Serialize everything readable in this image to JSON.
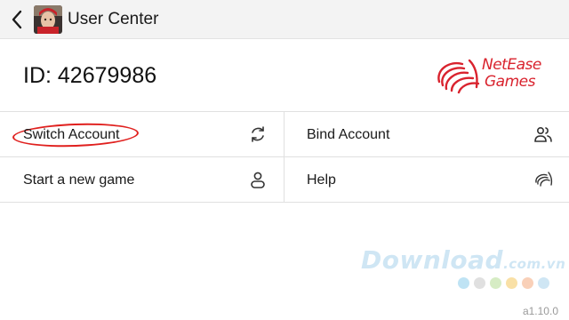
{
  "header": {
    "title": "User Center"
  },
  "account": {
    "id_text": "ID: 42679986"
  },
  "brand": {
    "logo_line1": "NetEase",
    "logo_line2": "Games",
    "color": "#d9232e"
  },
  "menu": {
    "items": [
      {
        "label": "Switch Account",
        "icon": "refresh-icon"
      },
      {
        "label": "Bind Account",
        "icon": "users-icon"
      },
      {
        "label": "Start a new game",
        "icon": "user-icon"
      },
      {
        "label": "Help",
        "icon": "netease-icon"
      }
    ]
  },
  "watermark": {
    "main": "Download",
    "suffix": ".com.vn",
    "dot_colors": [
      "#bfe3f4",
      "#e0e0e0",
      "#d6ecc4",
      "#f9e0a6",
      "#f9d0b8",
      "#cfe6f4"
    ]
  },
  "footer": {
    "version": "a1.10.0"
  }
}
